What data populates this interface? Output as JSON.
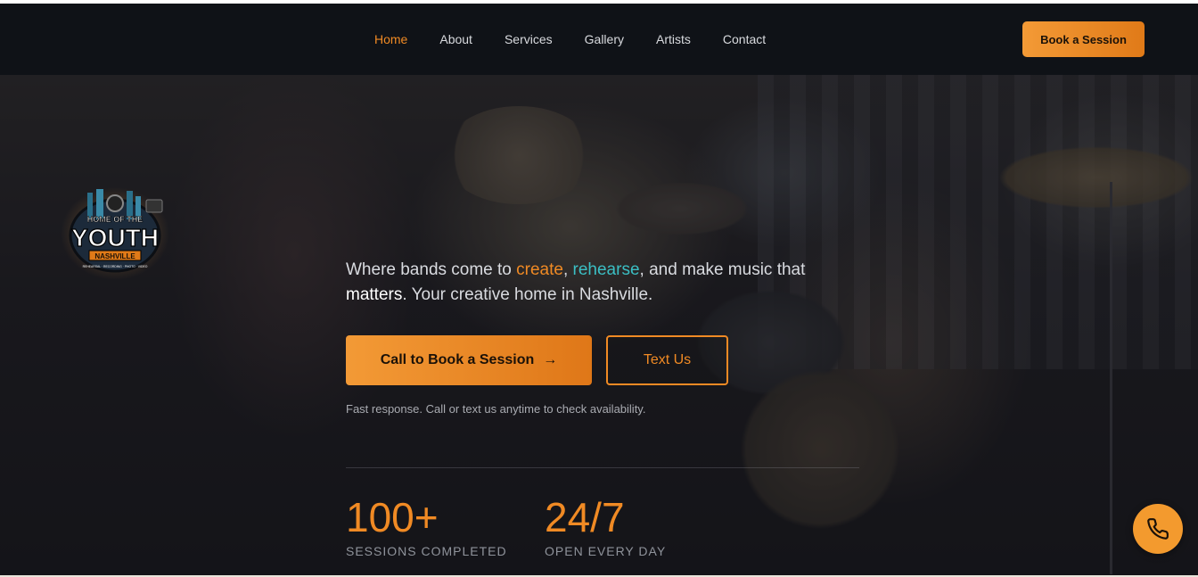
{
  "nav": {
    "links": [
      "Home",
      "About",
      "Services",
      "Gallery",
      "Artists",
      "Contact"
    ],
    "active": "Home",
    "cta": "Book a Session"
  },
  "logo": {
    "line1": "HOME OF THE",
    "line2": "YOUTH",
    "line3": "NASHVILLE",
    "line4": "REHEARSAL · RECORDING · PHOTO · VIDEO"
  },
  "hero": {
    "tagline_parts": {
      "p1": "Where bands come to ",
      "create": "create",
      "comma": ", ",
      "rehearse": "rehearse",
      "p2": ", and make music that ",
      "matters": "matters",
      "p3": ". Your creative home in Nashville."
    },
    "call_button": "Call to Book a Session",
    "call_arrow": "→",
    "text_button": "Text Us",
    "note": "Fast response. Call or text us anytime to check availability.",
    "stats": [
      {
        "value": "100+",
        "label": "SESSIONS COMPLETED"
      },
      {
        "value": "24/7",
        "label": "OPEN EVERY DAY"
      }
    ]
  },
  "colors": {
    "accent": "#f08a24",
    "teal": "#3bbfc4",
    "nav_bg": "#0f1217"
  },
  "icons": {
    "fab": "phone-icon",
    "arrow": "arrow-right-icon"
  }
}
